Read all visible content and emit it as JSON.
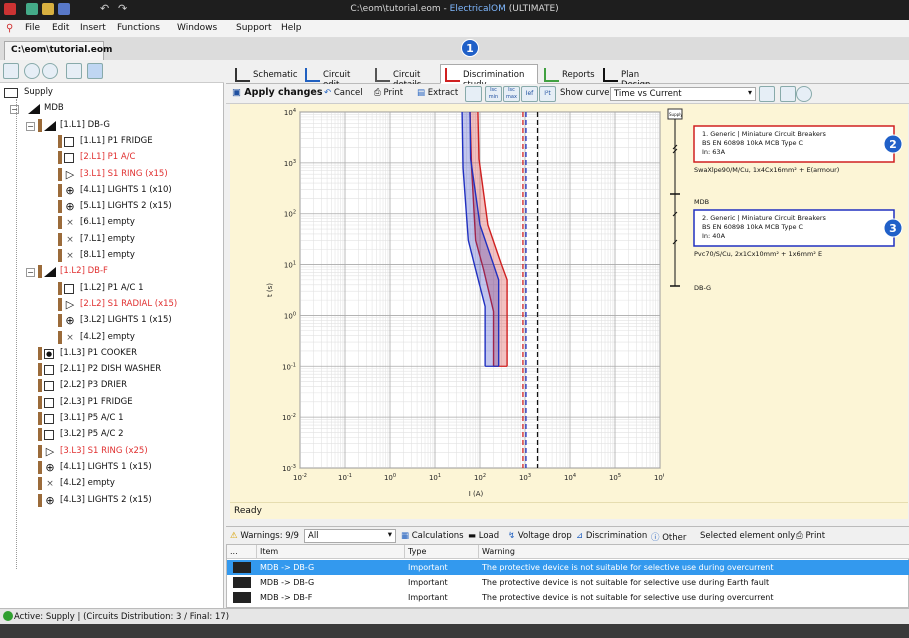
{
  "window": {
    "title_path": "C:\\eom\\tutorial.eom - ",
    "title_app": "ElectricalOM",
    "title_edition": "(ULTIMATE)"
  },
  "menu": [
    "File",
    "Edit",
    "Insert",
    "Functions",
    "Windows",
    "Support",
    "Help"
  ],
  "doc_tab": "C:\\eom\\tutorial.eom",
  "tree": [
    {
      "label": "Supply",
      "level": 0,
      "red": false,
      "kind": "supply"
    },
    {
      "label": "MDB",
      "level": 1,
      "red": false,
      "kind": "board"
    },
    {
      "label": "[1.L1] DB-G",
      "level": 2,
      "red": false,
      "kind": "board"
    },
    {
      "label": "[1.L1] P1 FRIDGE",
      "level": 3,
      "red": false,
      "kind": "box"
    },
    {
      "label": "[2.L1] P1 A/C",
      "level": 3,
      "red": true,
      "kind": "box"
    },
    {
      "label": "[3.L1] S1 RING (x15)",
      "level": 3,
      "red": true,
      "kind": "socket"
    },
    {
      "label": "[4.L1] LIGHTS 1 (x10)",
      "level": 3,
      "red": false,
      "kind": "light"
    },
    {
      "label": "[5.L1] LIGHTS 2 (x15)",
      "level": 3,
      "red": false,
      "kind": "light"
    },
    {
      "label": "[6.L1] empty",
      "level": 3,
      "red": false,
      "kind": "x"
    },
    {
      "label": "[7.L1] empty",
      "level": 3,
      "red": false,
      "kind": "x"
    },
    {
      "label": "[8.L1] empty",
      "level": 3,
      "red": false,
      "kind": "x"
    },
    {
      "label": "[1.L2] DB-F",
      "level": 2,
      "red": true,
      "kind": "board"
    },
    {
      "label": "[1.L2] P1 A/C 1",
      "level": 3,
      "red": false,
      "kind": "box"
    },
    {
      "label": "[2.L2] S1 RADIAL (x15)",
      "level": 3,
      "red": true,
      "kind": "socket"
    },
    {
      "label": "[3.L2] LIGHTS 1 (x15)",
      "level": 3,
      "red": false,
      "kind": "light"
    },
    {
      "label": "[4.L2] empty",
      "level": 3,
      "red": false,
      "kind": "x"
    },
    {
      "label": "[1.L3] P1 COOKER",
      "level": 2,
      "red": false,
      "kind": "cooker"
    },
    {
      "label": "[2.L1] P2 DISH WASHER",
      "level": 2,
      "red": false,
      "kind": "box"
    },
    {
      "label": "[2.L2] P3 DRIER",
      "level": 2,
      "red": false,
      "kind": "box"
    },
    {
      "label": "[2.L3] P1 FRIDGE",
      "level": 2,
      "red": false,
      "kind": "box"
    },
    {
      "label": "[3.L1] P5 A/C 1",
      "level": 2,
      "red": false,
      "kind": "box"
    },
    {
      "label": "[3.L2] P5 A/C 2",
      "level": 2,
      "red": false,
      "kind": "box"
    },
    {
      "label": "[3.L3] S1 RING (x25)",
      "level": 2,
      "red": true,
      "kind": "socket"
    },
    {
      "label": "[4.L1] LIGHTS 1 (x15)",
      "level": 2,
      "red": false,
      "kind": "light"
    },
    {
      "label": "[4.L2] empty",
      "level": 2,
      "red": false,
      "kind": "x"
    },
    {
      "label": "[4.L3] LIGHTS 2 (x15)",
      "level": 2,
      "red": false,
      "kind": "light"
    }
  ],
  "right_tabs": [
    {
      "label": "Schematic",
      "icon": "schematic-icon"
    },
    {
      "label": "Circuit edit",
      "icon": "circuit-edit-icon"
    },
    {
      "label": "Circuit details",
      "icon": "circuit-details-icon"
    },
    {
      "label": "Discrimination study",
      "icon": "discrimination-icon",
      "selected": true
    },
    {
      "label": "Reports",
      "icon": "reports-icon"
    },
    {
      "label": "Plan Design",
      "icon": "plan-design-icon"
    }
  ],
  "disc_toolbar": {
    "apply": "Apply changes",
    "cancel": "Cancel",
    "print": "Print",
    "extract": "Extract",
    "isc_min": "Isc min",
    "isc_max": "Isc max",
    "ief": "Ief",
    "show_curve_label": "Show curve",
    "show_curve_value": "Time vs Current"
  },
  "chart_data": {
    "type": "line",
    "title": "",
    "xlabel": "I (A)",
    "ylabel": "t (s)",
    "xscale": "log",
    "yscale": "log",
    "xlim": [
      0.01,
      1000000
    ],
    "ylim": [
      0.001,
      10000
    ],
    "x_ticks": [
      "10^-2",
      "10^-1",
      "10^0",
      "10^1",
      "10^2",
      "10^3",
      "10^4",
      "10^5",
      "10^6"
    ],
    "y_ticks": [
      "10^-3",
      "10^-2",
      "10^-1",
      "10^0",
      "10^1",
      "10^2",
      "10^3",
      "10^4"
    ],
    "grid": true,
    "series": [
      {
        "color": "#d02020",
        "band_low": [
          [
            60,
            10000
          ],
          [
            65,
            800
          ],
          [
            80,
            30
          ],
          [
            120,
            8
          ],
          [
            200,
            1.2
          ],
          [
            200,
            0.1
          ]
        ],
        "band_high": [
          [
            90,
            10000
          ],
          [
            95,
            1200
          ],
          [
            150,
            60
          ],
          [
            300,
            10
          ],
          [
            400,
            5
          ],
          [
            400,
            0.1
          ]
        ]
      },
      {
        "color": "#2030c0",
        "band_low": [
          [
            40,
            10000
          ],
          [
            42,
            800
          ],
          [
            55,
            30
          ],
          [
            80,
            8
          ],
          [
            130,
            1.5
          ],
          [
            130,
            0.1
          ]
        ],
        "band_high": [
          [
            60,
            10000
          ],
          [
            62,
            1200
          ],
          [
            100,
            60
          ],
          [
            200,
            10
          ],
          [
            260,
            5
          ],
          [
            260,
            0.1
          ]
        ]
      }
    ],
    "vlines": [
      {
        "x": 900,
        "color": "#d02020"
      },
      {
        "x": 1050,
        "color": "#2030c0"
      },
      {
        "x": 1900,
        "color": "#111"
      }
    ]
  },
  "diagram": {
    "supply_tag": "Supply",
    "box1": {
      "line1": "1. Generic | Miniature Circuit Breakers",
      "line2": "BS EN 60898 10kA MCB Type C",
      "line3": "In: 63A"
    },
    "cable1": "SwaXlpe90/M/Cu, 1x4Cx16mm² + E(armour)",
    "mdb": "MDB",
    "box2": {
      "line1": "2. Generic | Miniature Circuit Breakers",
      "line2": "BS EN 60898 10kA MCB Type C",
      "line3": "In: 40A"
    },
    "cable2": "Pvc70/S/Cu, 2x1Cx10mm² + 1x6mm² E",
    "dbg": "DB-G",
    "callouts": [
      "1",
      "2",
      "3"
    ]
  },
  "ready": "Ready",
  "warn_toolbar": {
    "warnings": "Warnings: 9/9",
    "filter": "All",
    "calc": "Calculations",
    "load": "Load",
    "vdrop": "Voltage drop",
    "disc": "Discrimination",
    "other": "Other",
    "selected_only": "Selected element only",
    "print": "Print"
  },
  "warn_table": {
    "headers": [
      "...",
      "Item",
      "Type",
      "Warning"
    ],
    "rows": [
      {
        "item": "MDB -> DB-G",
        "type": "Important",
        "warning": "The protective device is not suitable for selective use during overcurrent",
        "selected": true
      },
      {
        "item": "MDB -> DB-G",
        "type": "Important",
        "warning": "The protective device is not suitable for selective use during Earth fault",
        "selected": false
      },
      {
        "item": "MDB -> DB-F",
        "type": "Important",
        "warning": "The protective device is not suitable for selective use during overcurrent",
        "selected": false
      }
    ]
  },
  "status": "Active: Supply | (Circuits Distribution: 3 / Final: 17)"
}
